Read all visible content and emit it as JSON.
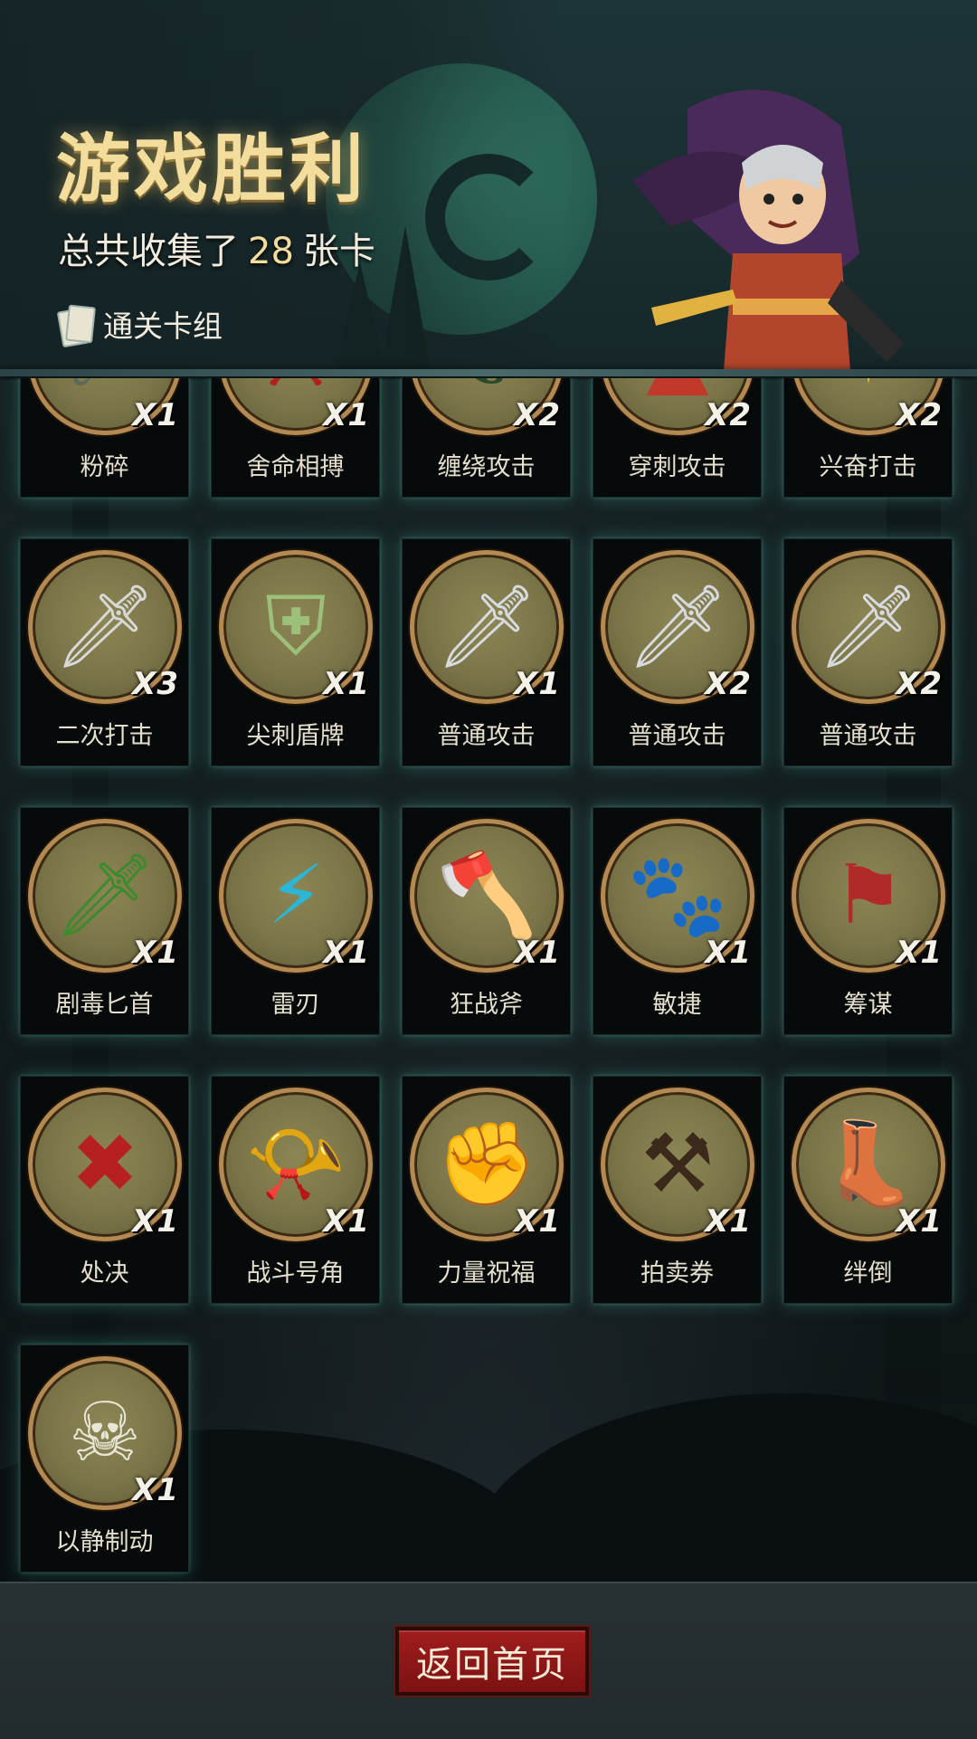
{
  "header": {
    "title": "游戏胜利",
    "subtitle_prefix": "总共收集了",
    "card_total": "28",
    "subtitle_suffix": "张卡",
    "deck_link_label": "通关卡组"
  },
  "cards": [
    {
      "name": "粉碎",
      "count": "X1",
      "icon": "meteor-icon"
    },
    {
      "name": "舍命相搏",
      "count": "X1",
      "icon": "bloody-strike-icon"
    },
    {
      "name": "缠绕攻击",
      "count": "X2",
      "icon": "thorn-vine-icon"
    },
    {
      "name": "穿刺攻击",
      "count": "X2",
      "icon": "spike-pierce-icon"
    },
    {
      "name": "兴奋打击",
      "count": "X2",
      "icon": "excited-fighter-icon"
    },
    {
      "name": "二次打击",
      "count": "X3",
      "icon": "twin-daggers-icon"
    },
    {
      "name": "尖刺盾牌",
      "count": "X1",
      "icon": "spiked-shield-icon"
    },
    {
      "name": "普通攻击",
      "count": "X1",
      "icon": "sword-icon"
    },
    {
      "name": "普通攻击",
      "count": "X2",
      "icon": "sword-icon"
    },
    {
      "name": "普通攻击",
      "count": "X2",
      "icon": "sword-icon"
    },
    {
      "name": "剧毒匕首",
      "count": "X1",
      "icon": "poison-dagger-icon"
    },
    {
      "name": "雷刃",
      "count": "X1",
      "icon": "lightning-blade-icon"
    },
    {
      "name": "狂战斧",
      "count": "X1",
      "icon": "berserker-axe-icon"
    },
    {
      "name": "敏捷",
      "count": "X1",
      "icon": "panther-icon"
    },
    {
      "name": "筹谋",
      "count": "X1",
      "icon": "battle-map-icon"
    },
    {
      "name": "处决",
      "count": "X1",
      "icon": "execution-icon"
    },
    {
      "name": "战斗号角",
      "count": "X1",
      "icon": "war-horn-icon"
    },
    {
      "name": "力量祝福",
      "count": "X1",
      "icon": "fist-icon"
    },
    {
      "name": "拍卖券",
      "count": "X1",
      "icon": "auction-hammer-icon"
    },
    {
      "name": "绊倒",
      "count": "X1",
      "icon": "trip-boot-icon"
    },
    {
      "name": "以静制动",
      "count": "X1",
      "icon": "skull-icon"
    }
  ],
  "footer": {
    "home_button_label": "返回首页"
  },
  "colors": {
    "title_gold": "#f3dd9c",
    "card_glow": "#50beaa",
    "medallion_bg": "#7a7448",
    "medallion_rim": "#b58a52",
    "button_red": "#a01d1d"
  }
}
